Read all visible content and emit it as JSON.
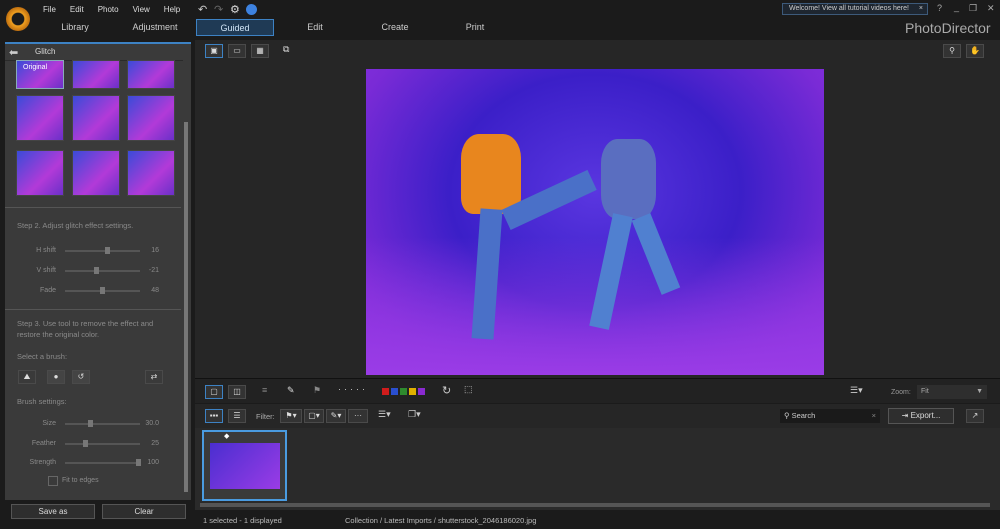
{
  "menu": [
    "File",
    "Edit",
    "Photo",
    "View",
    "Help"
  ],
  "tabs": [
    "Library",
    "Adjustment",
    "Guided",
    "Edit",
    "Create",
    "Print"
  ],
  "notification": "Welcome! View all tutorial videos here!",
  "app_title": "PhotoDirector",
  "panel": {
    "title": "Glitch",
    "original_label": "Original",
    "step2": "Step 2. Adjust glitch effect settings.",
    "sliders": [
      {
        "label": "H shift",
        "value": "16",
        "pct": 0.55
      },
      {
        "label": "V shift",
        "value": "-21",
        "pct": 0.4
      },
      {
        "label": "Fade",
        "value": "48",
        "pct": 0.48
      }
    ],
    "step3": "Step 3. Use tool to remove the effect and restore the original color.",
    "select_brush": "Select a brush:",
    "brush_settings": "Brush settings:",
    "brush_sliders": [
      {
        "label": "Size",
        "value": "30.0",
        "pct": 0.32
      },
      {
        "label": "Feather",
        "value": "25",
        "pct": 0.25
      },
      {
        "label": "Strength",
        "value": "100",
        "pct": 0.98
      }
    ],
    "fit_to_edges": "Fit to edges",
    "save_as": "Save as",
    "clear": "Clear"
  },
  "toolbar": {
    "zoom_label": "Zoom:",
    "zoom_value": "Fit",
    "filter_label": "Filter:",
    "search_placeholder": "Search",
    "export": "Export...",
    "colors": [
      "#d01c1c",
      "#2a4fd0",
      "#2e8a2e",
      "#e0b000",
      "#8a2ad0"
    ]
  },
  "status": {
    "selection": "1 selected - 1 displayed",
    "path": "Collection / Latest Imports / shutterstock_2046186020.jpg"
  }
}
